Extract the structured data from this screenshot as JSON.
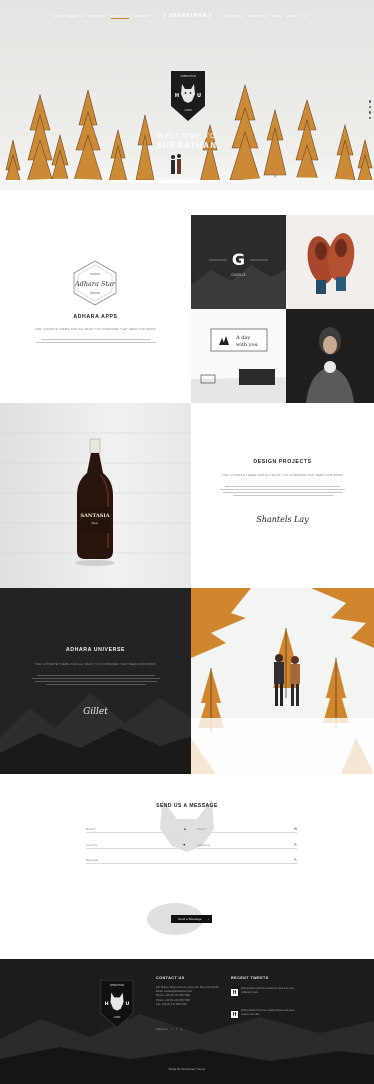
{
  "nav": {
    "left": [
      "Home",
      "About Us",
      "Services",
      "Portfolio",
      "Contact"
    ],
    "brand": "{ SHERATHAN }",
    "right": [
      "Our Team",
      "Portfolio",
      "Blog",
      "News",
      "Faq"
    ]
  },
  "hero": {
    "welcome_line1": "WELCOME TO",
    "welcome_line2": "SHERATHAN",
    "badge_top": "SHERATHAN",
    "badge_letters": [
      "H",
      "U"
    ],
    "badge_year": "1984"
  },
  "apps": {
    "logo_top": "STUDIO",
    "logo_script": "Adhara Star",
    "logo_bottom": "DESIGN",
    "title": "ADHARA APPS",
    "subtitle": "THE ULTIMATE THEME AND ALL WHAT YOU CONSIDER THAT NEED FOR WORK"
  },
  "tiles": {
    "g_letter": "G",
    "g_caption": "GAZELLE",
    "day_text_1": "A day",
    "day_text_2": "with you"
  },
  "bottle": {
    "brand": "SANTASIA",
    "sub": "Beer"
  },
  "design": {
    "title": "DESIGN PROJECTS",
    "subtitle": "THE ULTIMATE THEME AND ALL WHAT YOU CONSIDER THAT NEED FOR WORK",
    "signature": "Shantels Lay"
  },
  "universe": {
    "title": "ADHARA UNIVERSE",
    "subtitle": "THE ULTIMATE THEME AND ALL WHAT YOU CONSIDER THAT NEED FOR WORK",
    "signature": "Gillet"
  },
  "form": {
    "title": "SEND US A MESSAGE",
    "fields": {
      "name": "Name *",
      "email": "Email *",
      "country": "Country",
      "company": "Company",
      "message": "Message"
    },
    "send_label": "Send a Message",
    "send_arrow": "›"
  },
  "footer": {
    "contact_title": "CONTACT US",
    "contact_lines": [
      "227 Marion Street Avenue, Suite 123, New York 01010",
      "Email: contact@sherathan.com",
      "Phone: +00 (0) 123 4567 890",
      "Phone: +00 (0) 123 4567 890",
      "Fax: +00 (0) 123 4567 890"
    ],
    "follow_label": "Follow Us",
    "tweets_title": "RECENT TWEETS",
    "tweets": [
      {
        "icon": "H",
        "text": "@Sherathan Add this awesome theme to your collection soon"
      },
      {
        "icon": "H",
        "text": "@Sherathan Premium quality theme and great support we offer"
      }
    ],
    "bottom_text": "Made By Sherathan Theme"
  },
  "colors": {
    "accent": "#c98a2e",
    "dark": "#1c1c1e",
    "autumn": "#d08a2c"
  }
}
